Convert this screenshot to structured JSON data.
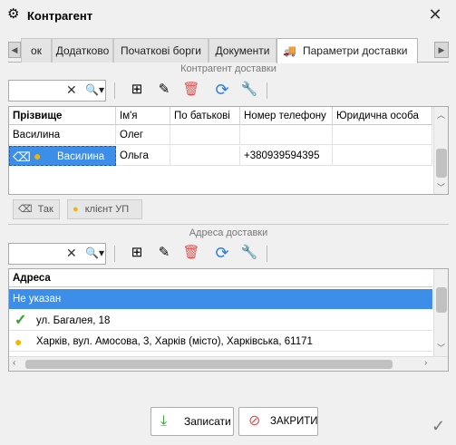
{
  "window": {
    "title": "Контрагент"
  },
  "tabs": [
    {
      "label": "ок",
      "active": false
    },
    {
      "label": "Додатково",
      "active": false
    },
    {
      "label": "Початкові борги",
      "active": false
    },
    {
      "label": "Документи",
      "active": false
    },
    {
      "label": "Параметри доставки",
      "active": true
    }
  ],
  "contractor_section": {
    "title": "Контрагент доставки",
    "search": {
      "value": "",
      "placeholder": ""
    },
    "columns": [
      "Прізвище",
      "Ім'я",
      "По батькові",
      "Номер телефону",
      "Юридична особа"
    ],
    "rows": [
      {
        "surname": "Василина",
        "name": "Олег",
        "patronymic": "",
        "phone": "",
        "legal": "",
        "selected": false
      },
      {
        "surname": "Василина",
        "name": "Ольга",
        "patronymic": "",
        "phone": "+380939594395",
        "legal": "",
        "selected": true
      }
    ],
    "legend": [
      {
        "label": "Так",
        "icon": "eraser-icon"
      },
      {
        "label": "клієнт УП",
        "icon": "pin-icon"
      }
    ]
  },
  "address_section": {
    "title": "Адреса доставки",
    "search": {
      "value": "",
      "placeholder": ""
    },
    "column": "Адреса",
    "rows": [
      {
        "text": "Не указан",
        "selected": true,
        "icon": ""
      },
      {
        "text": "ул. Багалея, 18",
        "selected": false,
        "icon": "check-icon"
      },
      {
        "text": "Харків, вул. Амосова, 3, Харків (місто), Харківська, 61171",
        "selected": false,
        "icon": "pin-icon"
      }
    ]
  },
  "footer": {
    "save_label": "Записати",
    "close_label": "ЗАКРИТИ"
  },
  "colors": {
    "accent": "#3d8ee8",
    "selection": "#3d8ee8",
    "delete": "#d9534f",
    "refresh": "#2e7de0",
    "check": "#2aa52a",
    "pin": "#f4b400"
  }
}
